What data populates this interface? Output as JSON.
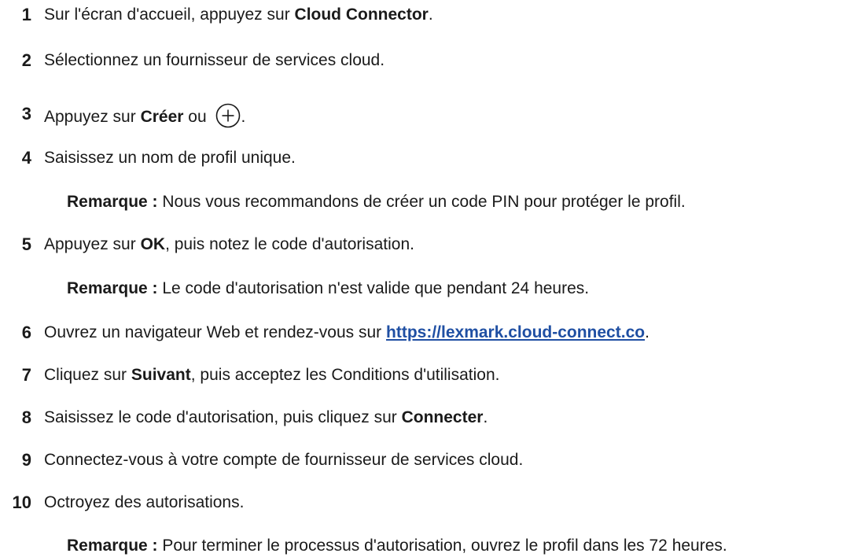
{
  "steps": [
    {
      "num": "1",
      "pre": "Sur l'écran d'accueil, appuyez sur ",
      "bold": "Cloud Connector",
      "post": "."
    },
    {
      "num": "2",
      "text": "Sélectionnez un fournisseur de services cloud."
    },
    {
      "num": "3",
      "pre": "Appuyez sur ",
      "bold": "Créer",
      "mid": " ou ",
      "post": ".",
      "icon": "plus-circle-icon"
    },
    {
      "num": "4",
      "text": "Saisissez un nom de profil unique."
    },
    {
      "num": "5",
      "pre": "Appuyez sur ",
      "bold": "OK",
      "post": ", puis notez le code d'autorisation."
    },
    {
      "num": "6",
      "pre": "Ouvrez un navigateur Web et rendez-vous sur ",
      "link": "https://lexmark.cloud-connect.co",
      "post": "."
    },
    {
      "num": "7",
      "pre": "Cliquez sur ",
      "bold": "Suivant",
      "post": ", puis acceptez les Conditions d'utilisation."
    },
    {
      "num": "8",
      "pre": "Saisissez le code d'autorisation, puis cliquez sur ",
      "bold": "Connecter",
      "post": "."
    },
    {
      "num": "9",
      "text": "Connectez-vous à votre compte de fournisseur de services cloud."
    },
    {
      "num": "10",
      "text": "Octroyez des autorisations."
    }
  ],
  "notes": {
    "note4": {
      "label": "Remarque :",
      "text": " Nous vous recommandons de créer un code PIN pour protéger le profil."
    },
    "note5": {
      "label": "Remarque :",
      "text": " Le code d'autorisation n'est valide que pendant 24 heures."
    },
    "note10": {
      "label": "Remarque :",
      "text": " Pour terminer le processus d'autorisation, ouvrez le profil dans les 72 heures."
    }
  }
}
